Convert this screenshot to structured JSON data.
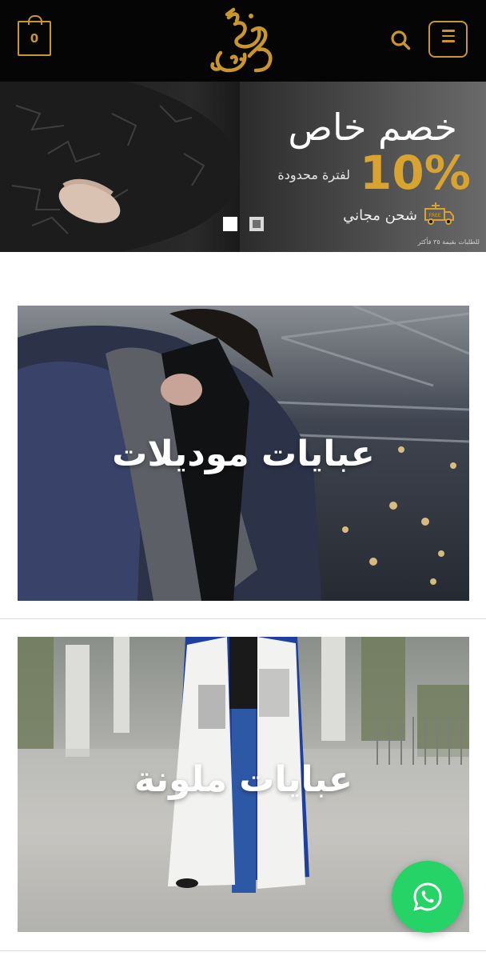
{
  "header": {
    "cart_count": "0",
    "logo_alt": "حرائر",
    "icons": {
      "cart": "shopping-bag-icon",
      "search": "search-icon",
      "menu": "hamburger-menu-icon"
    },
    "accent_color": "#c9952f",
    "background_color": "#050505"
  },
  "hero": {
    "title": "خصم خاص",
    "discount": "10%",
    "period": "لفترة محدودة",
    "shipping": "شحن مجاني",
    "free_badge": "FREE",
    "note": "للطلبات بقيمة ٣٥ فأكثر",
    "slides_total": 2,
    "slide_active": 1,
    "accent_color": "#d8a32e"
  },
  "categories": [
    {
      "label": "عبايات موديلات"
    },
    {
      "label": "عبايات ملونة"
    }
  ],
  "whatsapp": {
    "icon": "whatsapp-icon",
    "color": "#25d366"
  }
}
